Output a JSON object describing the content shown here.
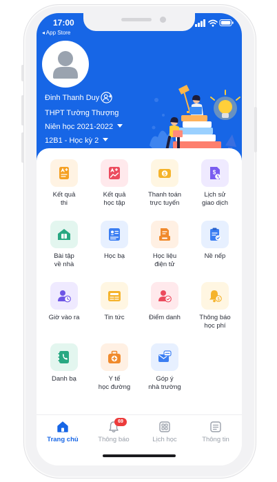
{
  "status_bar": {
    "time": "17:00",
    "back_label": "◂ App Store",
    "icons": [
      "signal-icon",
      "wifi-icon",
      "battery-icon"
    ]
  },
  "profile": {
    "name": "Đinh Thanh Duy",
    "school": "THPT Tường Thượng",
    "school_year": "Niên học 2021-2022",
    "class_term": "12B1 - Học kỳ 2"
  },
  "menu": [
    {
      "label": "Kết quả\nthi",
      "icon": "exam-result-icon",
      "bg": "#fff3e3",
      "color": "#f5a023"
    },
    {
      "label": "Kết quả\nhọc tập",
      "icon": "study-result-icon",
      "bg": "#ffe9ec",
      "color": "#ec4b5e"
    },
    {
      "label": "Thanh toán\ntrực tuyến",
      "icon": "online-payment-icon",
      "bg": "#fff6e2",
      "color": "#f5b32b"
    },
    {
      "label": "Lịch sử\ngiao dịch",
      "icon": "transaction-history-icon",
      "bg": "#efeaff",
      "color": "#7a5cf0"
    },
    {
      "label": "Bài tập\nvề nhà",
      "icon": "homework-icon",
      "bg": "#e3f6ef",
      "color": "#28a882"
    },
    {
      "label": "Học bạ",
      "icon": "report-card-icon",
      "bg": "#e7f0ff",
      "color": "#3b7ef2"
    },
    {
      "label": "Học liệu\nđiện tử",
      "icon": "e-learning-icon",
      "bg": "#fff0e3",
      "color": "#f08a2c"
    },
    {
      "label": "Nề nếp",
      "icon": "discipline-icon",
      "bg": "#e7f0ff",
      "color": "#3b7ef2"
    },
    {
      "label": "Giờ vào ra",
      "icon": "check-in-time-icon",
      "bg": "#efeaff",
      "color": "#6e56e6"
    },
    {
      "label": "Tin tức",
      "icon": "news-icon",
      "bg": "#fff6e2",
      "color": "#f5b32b"
    },
    {
      "label": "Điểm danh",
      "icon": "attendance-icon",
      "bg": "#ffe9ec",
      "color": "#ec4b5e"
    },
    {
      "label": "Thông báo\nhọc phí",
      "icon": "tuition-notice-icon",
      "bg": "#fff6e2",
      "color": "#f5b32b"
    },
    {
      "label": "Danh bạ",
      "icon": "contacts-icon",
      "bg": "#e3f6ef",
      "color": "#28a882"
    },
    {
      "label": "Y tế\nhọc đường",
      "icon": "school-health-icon",
      "bg": "#fff0e3",
      "color": "#f08a2c"
    },
    {
      "label": "Góp ý\nnhà trường",
      "icon": "feedback-icon",
      "bg": "#e7f0ff",
      "color": "#3b7ef2"
    }
  ],
  "tabbar": [
    {
      "label": "Trang chủ",
      "icon": "home-icon",
      "active": true
    },
    {
      "label": "Thông báo",
      "icon": "bell-icon",
      "badge": "69"
    },
    {
      "label": "Lịch học",
      "icon": "schedule-icon"
    },
    {
      "label": "Thông tin",
      "icon": "info-icon"
    }
  ],
  "colors": {
    "primary": "#1766e6",
    "badge": "#ec3b3b"
  }
}
